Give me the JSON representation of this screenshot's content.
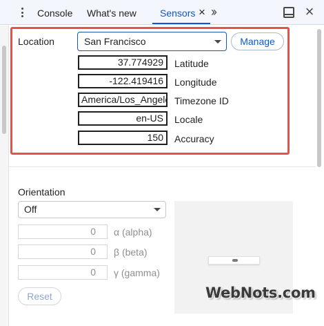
{
  "tabs": {
    "console": "Console",
    "whats_new": "What's new",
    "sensors": "Sensors",
    "active": "Sensors"
  },
  "icons": {
    "menu": "kebab-menu-icon",
    "tab_close": "close-icon",
    "more_tabs": "chevron-double-right-icon",
    "dock": "dock-side-icon",
    "close": "close-icon"
  },
  "location": {
    "label": "Location",
    "selected": "San Francisco",
    "manage_label": "Manage",
    "fields": {
      "latitude": {
        "value": "37.774929",
        "label": "Latitude"
      },
      "longitude": {
        "value": "-122.419416",
        "label": "Longitude"
      },
      "timezone": {
        "value": "America/Los_Angeles",
        "label": "Timezone ID"
      },
      "locale": {
        "value": "en-US",
        "label": "Locale"
      },
      "accuracy": {
        "value": "150",
        "label": "Accuracy"
      }
    }
  },
  "orientation": {
    "label": "Orientation",
    "selected": "Off",
    "alpha": {
      "value": "0",
      "label": "α (alpha)"
    },
    "beta": {
      "value": "0",
      "label": "β (beta)"
    },
    "gamma": {
      "value": "0",
      "label": "γ (gamma)"
    },
    "reset_label": "Reset"
  },
  "watermark": "WebNots.com",
  "colors": {
    "accent": "#0b57d0",
    "highlight_border": "#e3534c",
    "tab_bar_bg": "#f3f6fc"
  }
}
